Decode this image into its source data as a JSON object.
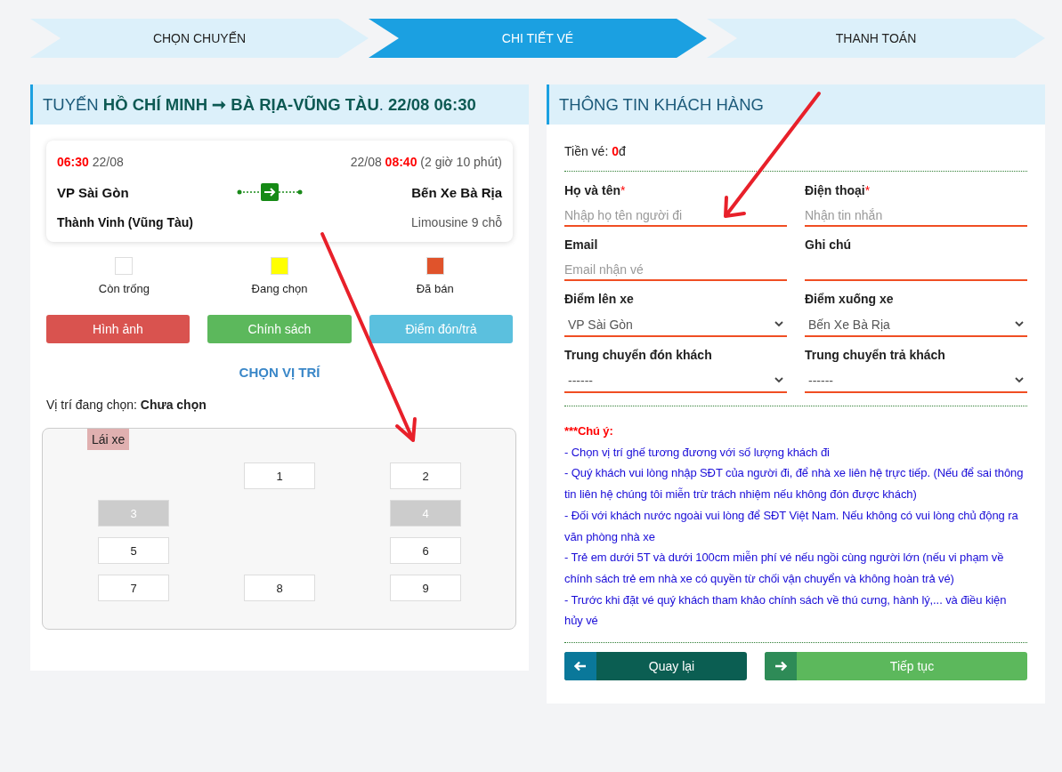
{
  "steps": [
    {
      "label": "CHỌN CHUYẾN",
      "selected": false
    },
    {
      "label": "CHI TIẾT VÉ",
      "selected": true
    },
    {
      "label": "THANH TOÁN",
      "selected": false
    }
  ],
  "trip_panel": {
    "title": "TUYẾN **HỒ CHÍ MINH ➞ BÀ RỊA-VŨNG TÀU**. **22/08 06:30**",
    "trip": {
      "depart_time": "06:30",
      "depart_date": "22/08",
      "arrive_date": "22/08",
      "arrive_time": "08:40",
      "duration": "(2 giờ 10 phút)",
      "from": "VP Sài Gòn",
      "to": "Bến Xe Bà Rịa",
      "operator": "Thành Vinh (Vũng Tàu)",
      "vehicle": "Limousine 9 chỗ"
    },
    "legend": [
      {
        "label": "Còn trống",
        "color": "#ffffff"
      },
      {
        "label": "Đang chọn",
        "color": "#ffff00"
      },
      {
        "label": "Đã bán",
        "color": "#e0532b"
      }
    ],
    "buttons": [
      {
        "label": "Hình ảnh",
        "kind": "danger"
      },
      {
        "label": "Chính sách",
        "kind": "success"
      },
      {
        "label": "Điểm đón/trả",
        "kind": "info"
      }
    ],
    "section_title": "CHỌN VỊ TRÍ",
    "selected_seat_label": "Vị trí đang chọn:",
    "selected_seat_value": "Chưa chọn",
    "seat_map": {
      "driver": "Lái xe",
      "rows": [
        {
          "seats": [
            {
              "kind": "aisle"
            },
            {
              "kind": "seat",
              "label": "1",
              "disabled": false
            },
            {
              "kind": "seat",
              "label": "2",
              "disabled": false
            }
          ]
        },
        {
          "seats": [
            {
              "kind": "seat",
              "label": "3",
              "disabled": true
            },
            {
              "kind": "aisle"
            },
            {
              "kind": "seat",
              "label": "4",
              "disabled": true
            }
          ]
        },
        {
          "seats": [
            {
              "kind": "seat",
              "label": "5",
              "disabled": false
            },
            {
              "kind": "aisle"
            },
            {
              "kind": "seat",
              "label": "6",
              "disabled": false
            }
          ]
        },
        {
          "seats": [
            {
              "kind": "seat",
              "label": "7",
              "disabled": false
            },
            {
              "kind": "seat",
              "label": "8",
              "disabled": false
            },
            {
              "kind": "seat",
              "label": "9",
              "disabled": false
            }
          ]
        }
      ]
    }
  },
  "customer_panel": {
    "title": "THÔNG TIN KHÁCH HÀNG",
    "price_label": "Tiền vé:",
    "price_value": "0",
    "price_unit": "đ",
    "fields": [
      {
        "label": "Họ và tên",
        "required_mark": "*",
        "kind": "input",
        "placeholder": "Nhập họ tên người đi"
      },
      {
        "label": "Điện thoại",
        "required_mark": "*",
        "kind": "input",
        "placeholder": "Nhận tin nhắn"
      },
      {
        "label": "Email",
        "kind": "input",
        "placeholder": "Email nhận vé"
      },
      {
        "label": "Ghi chú",
        "kind": "input"
      },
      {
        "label": "Điểm lên xe",
        "kind": "select",
        "value": "VP Sài Gòn"
      },
      {
        "label": "Điểm xuống xe",
        "kind": "select",
        "value": "Bến Xe Bà Rịa"
      },
      {
        "label": "Trung chuyển đón khách",
        "kind": "select",
        "value": "------"
      },
      {
        "label": "Trung chuyển trả khách",
        "kind": "select",
        "value": "------"
      }
    ],
    "notes_title": "***Chú ý:",
    "notes": [
      "- Chọn vị trí ghế tương đương với số lượng khách đi",
      "- Quý khách vui lòng nhập SĐT của người đi, để nhà xe liên hệ trực tiếp. (Nếu để sai thông tin liên hệ chúng tôi miễn trừ trách nhiệm nếu không đón được khách)",
      "- Đối với khách nước ngoài vui lòng để SĐT Việt Nam. Nếu không có vui lòng chủ động ra văn phòng nhà xe",
      "- Trẻ em dưới 5T và dưới 100cm miễn phí vé nếu ngồi cùng người lớn (nếu vi phạm về chính sách trẻ em nhà xe có quyền từ chối vận chuyển và không hoàn trả vé)",
      "- Trước khi đặt vé quý khách tham khảo chính sách về thú cưng, hành lý,... và điều kiện hủy vé"
    ],
    "actions": [
      {
        "label": "Quay lại",
        "kind": "back"
      },
      {
        "label": "Tiếp tục",
        "kind": "next"
      }
    ]
  }
}
